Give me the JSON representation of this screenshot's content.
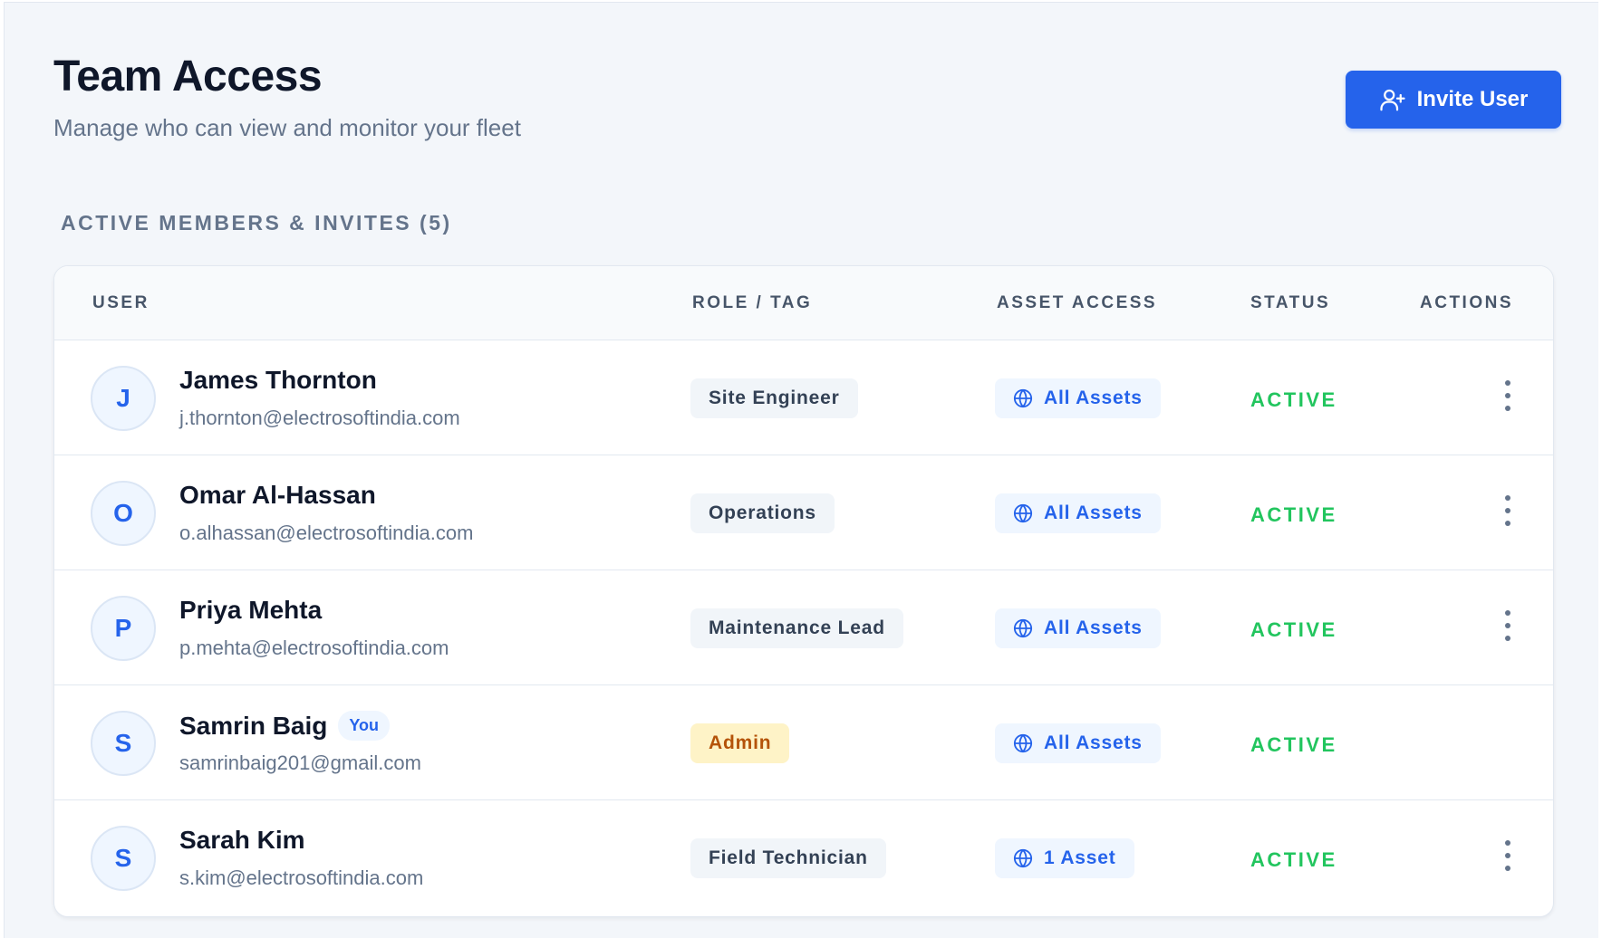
{
  "header": {
    "title": "Team Access",
    "subtitle": "Manage who can view and monitor your fleet",
    "invite_label": "Invite User"
  },
  "section": {
    "label": "ACTIVE MEMBERS & INVITES (5)"
  },
  "table": {
    "columns": [
      "USER",
      "ROLE / TAG",
      "ASSET ACCESS",
      "STATUS",
      "ACTIONS"
    ],
    "rows": [
      {
        "initial": "J",
        "name": "James Thornton",
        "email": "j.thornton@electrosoftindia.com",
        "role": "Site Engineer",
        "asset": "All Assets",
        "status": "ACTIVE",
        "you": ""
      },
      {
        "initial": "O",
        "name": "Omar Al-Hassan",
        "email": "o.alhassan@electrosoftindia.com",
        "role": "Operations",
        "asset": "All Assets",
        "status": "ACTIVE",
        "you": ""
      },
      {
        "initial": "P",
        "name": "Priya Mehta",
        "email": "p.mehta@electrosoftindia.com",
        "role": "Maintenance Lead",
        "asset": "All Assets",
        "status": "ACTIVE",
        "you": ""
      },
      {
        "initial": "S",
        "name": "Samrin Baig",
        "email": "samrinbaig201@gmail.com",
        "role": "Admin",
        "asset": "All Assets",
        "status": "ACTIVE",
        "you": "You"
      },
      {
        "initial": "S",
        "name": "Sarah Kim",
        "email": "s.kim@electrosoftindia.com",
        "role": "Field Technician",
        "asset": "1 Asset",
        "status": "ACTIVE",
        "you": ""
      }
    ]
  },
  "icons": {
    "invite": "user-plus-icon",
    "asset": "globe-icon",
    "actions": "kebab-menu-icon"
  },
  "colors": {
    "primary": "#2563eb",
    "active": "#22c55e",
    "admin_bg": "#fef3c7",
    "admin_text": "#b45309"
  }
}
